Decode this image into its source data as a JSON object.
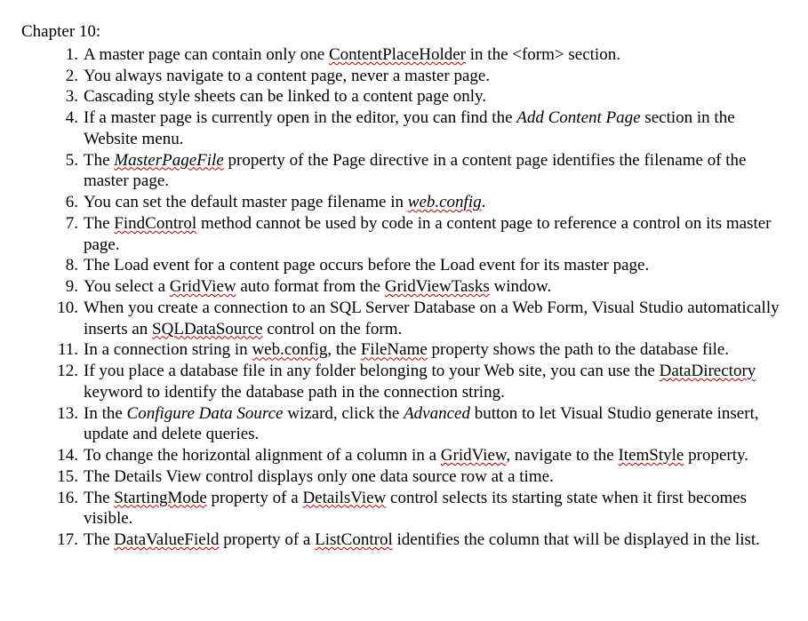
{
  "chapter_title": "Chapter 10:",
  "items": [
    {
      "segments": [
        {
          "t": "A master page can contain only one "
        },
        {
          "t": "ContentPlaceHolder",
          "squiggle": true
        },
        {
          "t": " in the <form> section."
        }
      ]
    },
    {
      "segments": [
        {
          "t": "You always navigate to a content page, never a master page."
        }
      ]
    },
    {
      "segments": [
        {
          "t": "Cascading style sheets can be linked to a content page only."
        }
      ]
    },
    {
      "segments": [
        {
          "t": "If a master page is currently open in the editor, you can find the "
        },
        {
          "t": "Add Content Page",
          "italic": true
        },
        {
          "t": " section in the Website menu."
        }
      ]
    },
    {
      "segments": [
        {
          "t": "The "
        },
        {
          "t": "MasterPageFile",
          "italic": true,
          "squiggle": true
        },
        {
          "t": " property of the Page directive in a content page identifies the filename of the master page."
        }
      ]
    },
    {
      "segments": [
        {
          "t": "You can set the default master page filename in "
        },
        {
          "t": "web.config",
          "italic": true,
          "squiggle": true
        },
        {
          "t": "."
        }
      ]
    },
    {
      "segments": [
        {
          "t": "The "
        },
        {
          "t": "FindControl",
          "squiggle": true
        },
        {
          "t": " method cannot be used by code in a content page to reference a control on its master page."
        }
      ]
    },
    {
      "segments": [
        {
          "t": "The Load event for a content page occurs before the Load event for its master page."
        }
      ]
    },
    {
      "segments": [
        {
          "t": "You select a "
        },
        {
          "t": "GridView",
          "squiggle": true
        },
        {
          "t": " auto format from the "
        },
        {
          "t": "GridViewTasks",
          "squiggle": true
        },
        {
          "t": " window."
        }
      ]
    },
    {
      "segments": [
        {
          "t": "When you create a connection to an SQL Server Database on a Web Form, Visual Studio automatically inserts an "
        },
        {
          "t": "SQLDataSource",
          "squiggle": true
        },
        {
          "t": " control on the form."
        }
      ]
    },
    {
      "segments": [
        {
          "t": "In a connection string in "
        },
        {
          "t": "web.config",
          "squiggle": true
        },
        {
          "t": ", the "
        },
        {
          "t": "FileName",
          "squiggle": true
        },
        {
          "t": " property shows the path to the database file."
        }
      ]
    },
    {
      "segments": [
        {
          "t": "If you place a database file in any folder belonging to your Web site, you can use the "
        },
        {
          "t": "DataDirectory",
          "squiggle": true
        },
        {
          "t": " keyword to identify the database path in the connection string."
        }
      ]
    },
    {
      "segments": [
        {
          "t": "In the "
        },
        {
          "t": "Configure Data Source",
          "italic": true
        },
        {
          "t": " wizard, click the "
        },
        {
          "t": "Advanced",
          "italic": true
        },
        {
          "t": " button to let Visual Studio generate insert, update and delete queries."
        }
      ]
    },
    {
      "segments": [
        {
          "t": "To change the horizontal alignment of a column in a "
        },
        {
          "t": "GridView",
          "squiggle": true
        },
        {
          "t": ", navigate to the "
        },
        {
          "t": "ItemStyle",
          "squiggle": true
        },
        {
          "t": " property."
        }
      ]
    },
    {
      "segments": [
        {
          "t": "The Details View control displays only one data source row at a time."
        }
      ]
    },
    {
      "segments": [
        {
          "t": "The "
        },
        {
          "t": "StartingMode",
          "squiggle": true
        },
        {
          "t": " property of a "
        },
        {
          "t": "DetailsView",
          "squiggle": true
        },
        {
          "t": " control selects its starting state when it first becomes visible."
        }
      ]
    },
    {
      "segments": [
        {
          "t": "The "
        },
        {
          "t": "DataValueField",
          "squiggle": true
        },
        {
          "t": " property of a "
        },
        {
          "t": "ListControl",
          "squiggle": true
        },
        {
          "t": " identifies the column that will be displayed in the list."
        }
      ]
    }
  ]
}
